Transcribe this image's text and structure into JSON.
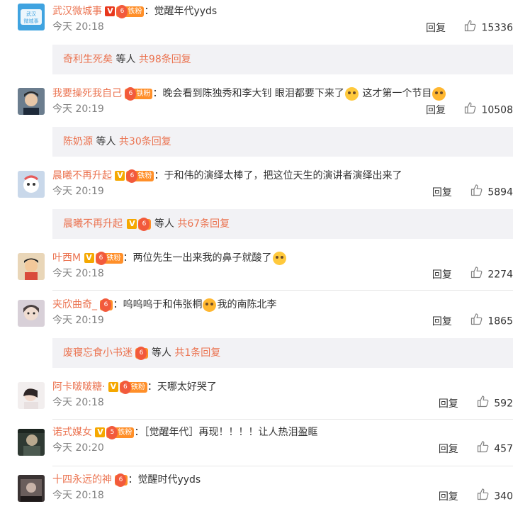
{
  "colors": {
    "username": "#eb7350",
    "accent": "#eb7350",
    "sub_bg": "#f2f2f5",
    "time": "#808080"
  },
  "labels": {
    "reply": "回复",
    "etc": "等人"
  },
  "comments": [
    {
      "user": "武汉微城事",
      "verified": "red-v",
      "fan_label": "铁粉",
      "level": "6",
      "colon": "：",
      "text": "觉醒年代yyds",
      "time": "今天 20:18",
      "likes": "15336",
      "sub": {
        "name": "奇利生死矣",
        "count": "共98条回复"
      }
    },
    {
      "user": "我要操死我自己",
      "verified": "",
      "fan_label": "铁粉",
      "level": "6",
      "colon": "：",
      "text": "晚会看到陈独秀和李大钊 眼泪都要下来了",
      "text2": " 这才第一个节目",
      "time": "今天 20:19",
      "likes": "10508",
      "sub": {
        "name": "陈奶源",
        "count": "共30条回复"
      }
    },
    {
      "user": "晨曦不再升起",
      "verified": "v",
      "fan_label": "铁粉",
      "level": "6",
      "colon": "：",
      "text": "于和伟的演绎太棒了，把这位天生的演讲者演绎出来了",
      "time": "今天 20:19",
      "likes": "5894",
      "sub": {
        "name": "晨曦不再升起",
        "count": "共67条回复"
      }
    },
    {
      "user": "叶西M",
      "verified": "v",
      "fan_label": "铁粉",
      "level": "6",
      "colon": "：",
      "text": "两位先生一出来我的鼻子就酸了",
      "time": "今天 20:18",
      "likes": "2274"
    },
    {
      "user": "夹欣曲奇_",
      "verified": "",
      "fan_label": "",
      "level": "6",
      "colon": "：",
      "text": "呜呜呜于和伟张桐",
      "text2": "我的南陈北李",
      "time": "今天 20:19",
      "likes": "1865",
      "sub": {
        "name": "废寝忘食小书迷",
        "count": "共1条回复"
      }
    },
    {
      "user": "阿卡啵啵糖·",
      "verified": "v",
      "fan_label": "铁粉",
      "level": "6",
      "colon": "：",
      "text": "天哪太好哭了",
      "time": "今天 20:18",
      "likes": "592"
    },
    {
      "user": "诺式媒女",
      "verified": "v",
      "fan_label": "铁粉",
      "level": "5",
      "colon": "：",
      "text": "［觉醒年代］再现！！！！让人热泪盈眶",
      "time": "今天 20:20",
      "likes": "457"
    },
    {
      "user": "十四永远的神",
      "verified": "",
      "fan_label": "",
      "level": "6",
      "colon": "：",
      "text": "觉醒时代yyds",
      "time": "今天 20:18",
      "likes": "340"
    }
  ]
}
